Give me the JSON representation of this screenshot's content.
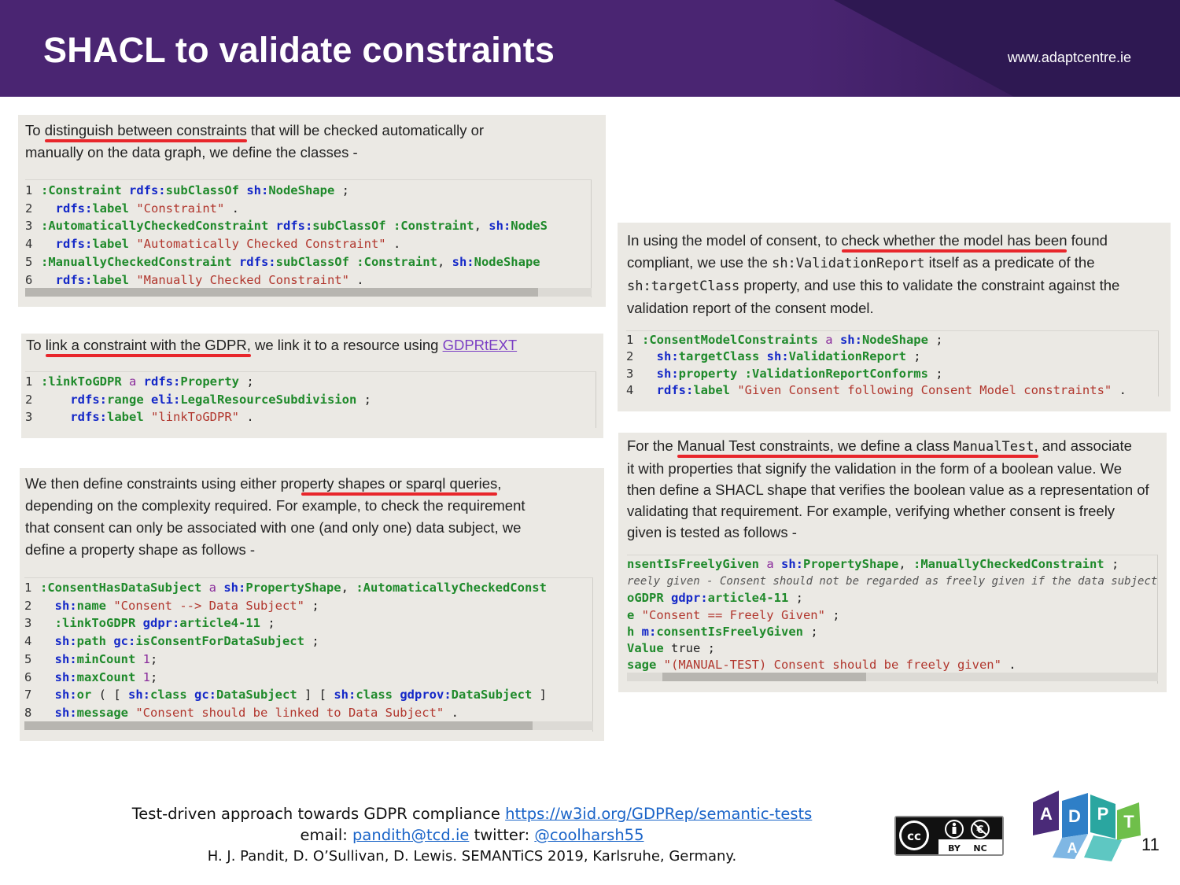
{
  "header": {
    "title": "SHACL to validate constraints",
    "website": "www.adaptcentre.ie"
  },
  "panel1": {
    "text": [
      "To ",
      "distinguish between constraints",
      " that will be checked automatically or",
      "manually on the data graph, we define the classes -"
    ],
    "code": [
      [
        [
          "1 ",
          "ln"
        ],
        [
          ":Constraint ",
          "g"
        ],
        [
          "rdfs:",
          "b"
        ],
        [
          "subClassOf ",
          "g"
        ],
        [
          "sh:",
          "b"
        ],
        [
          "NodeShape",
          "g"
        ],
        [
          " ;",
          "p"
        ]
      ],
      [
        [
          "2 ",
          "ln"
        ],
        [
          "  rdfs:",
          "b"
        ],
        [
          "label ",
          "g"
        ],
        [
          "\"Constraint\"",
          "r"
        ],
        [
          " .",
          "p"
        ]
      ],
      [
        [
          "3 ",
          "ln"
        ],
        [
          ":AutomaticallyCheckedConstraint ",
          "g"
        ],
        [
          "rdfs:",
          "b"
        ],
        [
          "subClassOf ",
          "g"
        ],
        [
          ":Constraint",
          "g"
        ],
        [
          ", ",
          "p"
        ],
        [
          "sh:",
          "b"
        ],
        [
          "NodeS",
          "g"
        ]
      ],
      [
        [
          "4 ",
          "ln"
        ],
        [
          "  rdfs:",
          "b"
        ],
        [
          "label ",
          "g"
        ],
        [
          "\"Automatically Checked Constraint\"",
          "r"
        ],
        [
          " .",
          "p"
        ]
      ],
      [
        [
          "5 ",
          "ln"
        ],
        [
          ":ManuallyCheckedConstraint ",
          "g"
        ],
        [
          "rdfs:",
          "b"
        ],
        [
          "subClassOf ",
          "g"
        ],
        [
          ":Constraint",
          "g"
        ],
        [
          ", ",
          "p"
        ],
        [
          "sh:",
          "b"
        ],
        [
          "NodeShape",
          "g"
        ]
      ],
      [
        [
          "6 ",
          "ln"
        ],
        [
          "  rdfs:",
          "b"
        ],
        [
          "label ",
          "g"
        ],
        [
          "\"Manually Checked Constraint\"",
          "r"
        ],
        [
          " .",
          "p"
        ]
      ]
    ]
  },
  "panel2": {
    "text": [
      "To ",
      "link a constraint with the GDPR,",
      " we link it to a resource using ",
      "GDPRtEXT"
    ],
    "code": [
      [
        [
          "1 ",
          "ln"
        ],
        [
          ":linkToGDPR ",
          "g"
        ],
        [
          "a ",
          "pu"
        ],
        [
          "rdfs:",
          "b"
        ],
        [
          "Property",
          "g"
        ],
        [
          " ;",
          "p"
        ]
      ],
      [
        [
          "2 ",
          "ln"
        ],
        [
          "    rdfs:",
          "b"
        ],
        [
          "range ",
          "g"
        ],
        [
          "eli:",
          "b"
        ],
        [
          "LegalResourceSubdivision",
          "g"
        ],
        [
          " ;",
          "p"
        ]
      ],
      [
        [
          "3 ",
          "ln"
        ],
        [
          "    rdfs:",
          "b"
        ],
        [
          "label ",
          "g"
        ],
        [
          "\"linkToGDPR\"",
          "r"
        ],
        [
          " .",
          "p"
        ]
      ]
    ]
  },
  "panel3": {
    "text": [
      "We then define constraints using either pro",
      "perty shapes or sparql queries",
      ",",
      "depending on the complexity required. For example, to check the requirement",
      "that consent can only be associated with one (and only one) data subject, we",
      "define a property shape as follows -"
    ],
    "code": [
      [
        [
          "1 ",
          "ln"
        ],
        [
          ":ConsentHasDataSubject ",
          "g"
        ],
        [
          "a ",
          "pu"
        ],
        [
          "sh:",
          "b"
        ],
        [
          "PropertyShape",
          "g"
        ],
        [
          ", ",
          "p"
        ],
        [
          ":AutomaticallyCheckedConst",
          "g"
        ]
      ],
      [
        [
          "2 ",
          "ln"
        ],
        [
          "  sh:",
          "b"
        ],
        [
          "name ",
          "g"
        ],
        [
          "\"Consent --> Data Subject\"",
          "r"
        ],
        [
          " ;",
          "p"
        ]
      ],
      [
        [
          "3 ",
          "ln"
        ],
        [
          "  :linkToGDPR ",
          "g"
        ],
        [
          "gdpr:",
          "b"
        ],
        [
          "article4-11",
          "g"
        ],
        [
          " ;",
          "p"
        ]
      ],
      [
        [
          "4 ",
          "ln"
        ],
        [
          "  sh:",
          "b"
        ],
        [
          "path ",
          "g"
        ],
        [
          "gc:",
          "b"
        ],
        [
          "isConsentForDataSubject",
          "g"
        ],
        [
          " ;",
          "p"
        ]
      ],
      [
        [
          "5 ",
          "ln"
        ],
        [
          "  sh:",
          "b"
        ],
        [
          "minCount ",
          "g"
        ],
        [
          "1",
          "pu"
        ],
        [
          ";",
          "p"
        ]
      ],
      [
        [
          "6 ",
          "ln"
        ],
        [
          "  sh:",
          "b"
        ],
        [
          "maxCount ",
          "g"
        ],
        [
          "1",
          "pu"
        ],
        [
          ";",
          "p"
        ]
      ],
      [
        [
          "7 ",
          "ln"
        ],
        [
          "  sh:",
          "b"
        ],
        [
          "or ",
          "g"
        ],
        [
          "( [ ",
          "p"
        ],
        [
          "sh:",
          "b"
        ],
        [
          "class ",
          "g"
        ],
        [
          "gc:",
          "b"
        ],
        [
          "DataSubject",
          "g"
        ],
        [
          " ] [ ",
          "p"
        ],
        [
          "sh:",
          "b"
        ],
        [
          "class ",
          "g"
        ],
        [
          "gdprov:",
          "b"
        ],
        [
          "DataSubject",
          "g"
        ],
        [
          " ]",
          "p"
        ]
      ],
      [
        [
          "8 ",
          "ln"
        ],
        [
          "  sh:",
          "b"
        ],
        [
          "message ",
          "g"
        ],
        [
          "\"Consent should be linked to Data Subject\"",
          "r"
        ],
        [
          " .",
          "p"
        ]
      ]
    ]
  },
  "panel4": {
    "text": [
      "In using the model of consent, to ",
      "check whether the model has been",
      " found",
      "compliant, we use the ",
      "sh:ValidationReport",
      " itself as a predicate of the",
      "sh:targetClass",
      " property, and use this to validate the constraint against the",
      "validation report of the consent model."
    ],
    "code": [
      [
        [
          "1 ",
          "ln"
        ],
        [
          ":ConsentModelConstraints ",
          "g"
        ],
        [
          "a ",
          "pu"
        ],
        [
          "sh:",
          "b"
        ],
        [
          "NodeShape",
          "g"
        ],
        [
          " ;",
          "p"
        ]
      ],
      [
        [
          "2 ",
          "ln"
        ],
        [
          "  sh:",
          "b"
        ],
        [
          "targetClass ",
          "g"
        ],
        [
          "sh:",
          "b"
        ],
        [
          "ValidationReport",
          "g"
        ],
        [
          " ;",
          "p"
        ]
      ],
      [
        [
          "3 ",
          "ln"
        ],
        [
          "  sh:",
          "b"
        ],
        [
          "property ",
          "g"
        ],
        [
          ":ValidationReportConforms",
          "g"
        ],
        [
          " ;",
          "p"
        ]
      ],
      [
        [
          "4 ",
          "ln"
        ],
        [
          "  rdfs:",
          "b"
        ],
        [
          "label ",
          "g"
        ],
        [
          "\"Given Consent following Consent Model constraints\"",
          "r"
        ],
        [
          " .",
          "p"
        ]
      ]
    ]
  },
  "panel5": {
    "text": [
      "For the ",
      "Manual Test constraints, we define a class ",
      "ManualTest",
      ",",
      " and associate",
      "it with properties that signify the validation in the form of a boolean value. We",
      "then define a SHACL shape that verifies the boolean value as a representation of",
      "validating that requirement. For example, verifying whether consent is freely",
      "given is tested as follows -"
    ],
    "code": [
      [
        [
          "nsentIsFreelyGiven ",
          "g"
        ],
        [
          "a ",
          "pu"
        ],
        [
          "sh:",
          "b"
        ],
        [
          "PropertyShape",
          "g"
        ],
        [
          ", ",
          "p"
        ],
        [
          ":ManuallyCheckedConstraint",
          "g"
        ],
        [
          " ;",
          "p"
        ]
      ],
      [
        [
          "reely given - Consent should not be regarded as freely given if the data subject",
          "c"
        ]
      ],
      [
        [
          "oGDPR ",
          "g"
        ],
        [
          "gdpr:",
          "b"
        ],
        [
          "article4-11",
          "g"
        ],
        [
          " ;",
          "p"
        ]
      ],
      [
        [
          "e ",
          "g"
        ],
        [
          "\"Consent == Freely Given\"",
          "r"
        ],
        [
          " ;",
          "p"
        ]
      ],
      [
        [
          "h ",
          "g"
        ],
        [
          "m:",
          "b"
        ],
        [
          "consentIsFreelyGiven",
          "g"
        ],
        [
          " ;",
          "p"
        ]
      ],
      [
        [
          "Value ",
          "g"
        ],
        [
          "true",
          "p"
        ],
        [
          " ;",
          "p"
        ]
      ],
      [
        [
          "sage ",
          "g"
        ],
        [
          "\"(MANUAL-TEST) Consent should be freely given\"",
          "r"
        ],
        [
          " .",
          "p"
        ]
      ]
    ]
  },
  "footer": {
    "line1_text": "Test-driven approach towards GDPR compliance ",
    "line1_link": "https://w3id.org/GDPRep/semantic-tests",
    "line2_prefix": "email: ",
    "line2_email": "pandith@tcd.ie",
    "line2_mid": " twitter: ",
    "line2_twitter": "@coolharsh55",
    "line3": "H. J. Pandit, D. O’Sullivan, D. Lewis. SEMANTiCS 2019, Karlsruhe, Germany."
  },
  "license": {
    "label_by": "BY",
    "label_nc": "NC",
    "icon": "cc-by-nc-icon"
  },
  "logo": {
    "letters": [
      "A",
      "D",
      "A",
      "P",
      "T"
    ],
    "icon": "adapt-logo-icon"
  },
  "page_number": "11"
}
